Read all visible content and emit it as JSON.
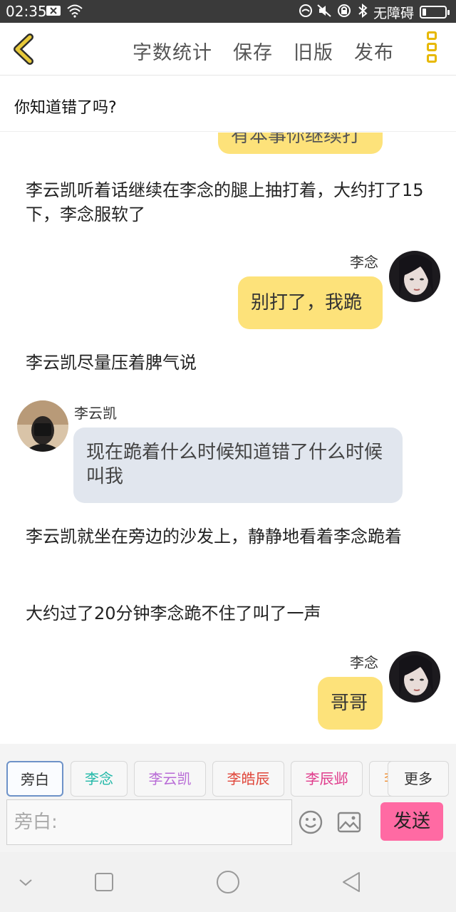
{
  "status_bar": {
    "time": "02:35",
    "network_text": "无障碍",
    "battery_level": 0.15
  },
  "toolbar": {
    "back_icon": "chevron-left-icon",
    "word_count": "字数统计",
    "save": "保存",
    "old_version": "旧版",
    "publish": "发布",
    "menu_icon": "more-vertical-icon",
    "accent_color": "#e7b800"
  },
  "story": {
    "title": "你知道错了吗?"
  },
  "chat": {
    "top_partial_text": "有本事你继续打",
    "narration_1": "李云凯听着话继续在李念的腿上抽打着，大约打了15下，李念服软了",
    "msg_1": {
      "speaker": "李念",
      "text": "别打了，我跪"
    },
    "narration_2": "李云凯尽量压着脾气说",
    "msg_2": {
      "speaker": "李云凯",
      "text": "现在跪着什么时候知道错了什么时候叫我"
    },
    "narration_3": "李云凯就坐在旁边的沙发上，静静地看着李念跪着",
    "narration_4": "大约过了20分钟李念跪不住了叫了一声",
    "msg_3": {
      "speaker": "李念",
      "text": "哥哥"
    }
  },
  "roles": {
    "items": [
      {
        "label": "旁白",
        "color": "#333333"
      },
      {
        "label": "李念",
        "color": "#22b8a8"
      },
      {
        "label": "李云凯",
        "color": "#b86bd6"
      },
      {
        "label": "李皓辰",
        "color": "#e0463a"
      },
      {
        "label": "李辰邺",
        "color": "#e03c8c"
      },
      {
        "label": "李",
        "color": "#f08a2a"
      }
    ],
    "more": "更多"
  },
  "composer": {
    "placeholder": "旁白:",
    "emoji_icon": "smiley-icon",
    "image_icon": "image-icon",
    "send": "发送",
    "send_color": "#ff6aa3"
  },
  "colors": {
    "yellow_bubble": "#fde27a",
    "grey_bubble": "#e1e6ee"
  }
}
